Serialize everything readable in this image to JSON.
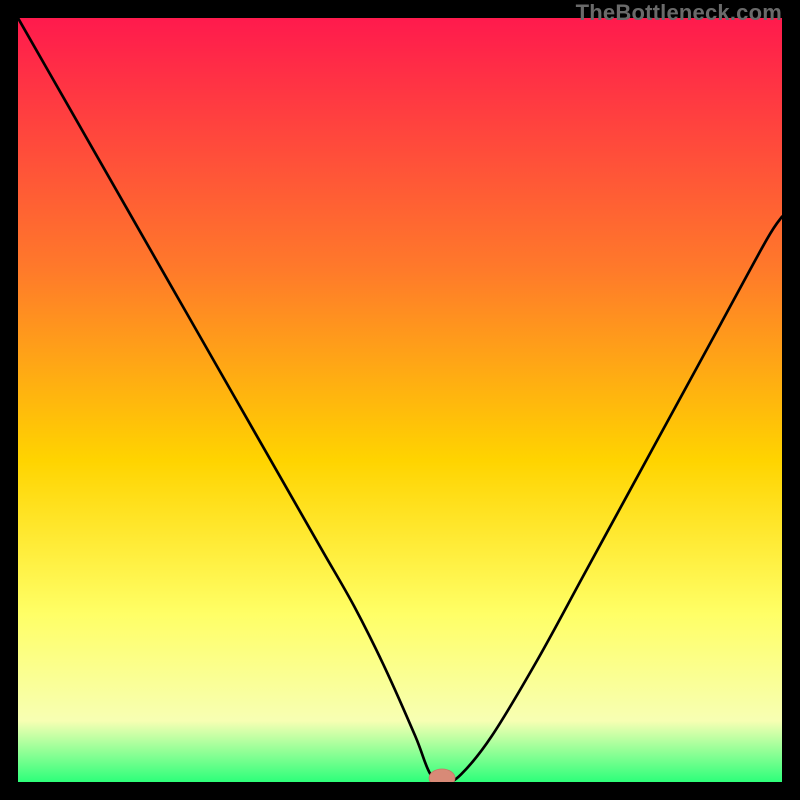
{
  "watermark": "TheBottleneck.com",
  "colors": {
    "frame": "#000000",
    "curve": "#000000",
    "marker_fill": "#d88a77",
    "marker_stroke": "#c77464",
    "gradient": {
      "top": "#ff1a4d",
      "mid1": "#ff7a2a",
      "mid2": "#ffd400",
      "mid3": "#ffff66",
      "mid4": "#f7ffb3",
      "bottom": "#2dff7a"
    }
  },
  "chart_data": {
    "type": "line",
    "title": "",
    "xlabel": "",
    "ylabel": "",
    "xlim": [
      0,
      100
    ],
    "ylim": [
      0,
      100
    ],
    "annotations": [
      "TheBottleneck.com"
    ],
    "comment": "V-shaped bottleneck curve over heat gradient; minimum near x≈55 at y≈0. Values estimated from pixels.",
    "series": [
      {
        "name": "bottleneck-curve",
        "x": [
          0,
          4,
          8,
          12,
          16,
          20,
          24,
          28,
          32,
          36,
          40,
          44,
          48,
          52,
          54,
          56,
          58,
          62,
          68,
          74,
          80,
          86,
          92,
          98,
          100
        ],
        "y": [
          100,
          93,
          86,
          79,
          72,
          65,
          58,
          51,
          44,
          37,
          30,
          23,
          15,
          6,
          1,
          0,
          1,
          6,
          16,
          27,
          38,
          49,
          60,
          71,
          74
        ]
      }
    ],
    "marker": {
      "x": 55.5,
      "y": 0.5,
      "rx": 1.7,
      "ry": 1.2
    }
  }
}
